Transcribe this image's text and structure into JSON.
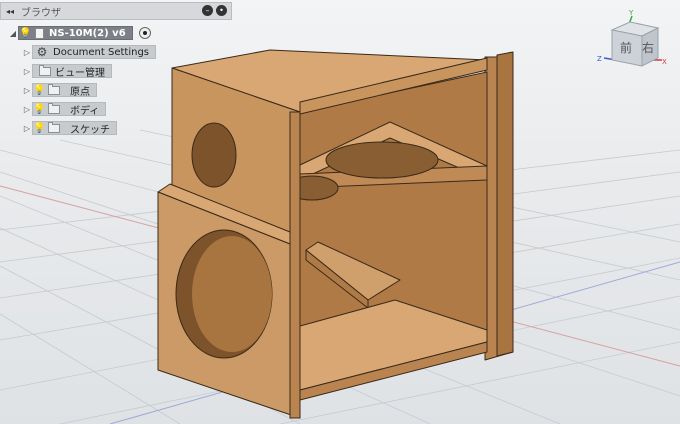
{
  "browser": {
    "title": "ブラウザ",
    "collapse_icon": "double-left-arrow-icon",
    "root": {
      "label": "NS-10M(2) v6"
    },
    "items": [
      {
        "label": "Document Settings",
        "icon": "gear-icon"
      },
      {
        "label": "ビュー管理",
        "icon": "folder-icon"
      },
      {
        "label": "原点",
        "icon": "folder-icon"
      },
      {
        "label": "ボディ",
        "icon": "folder-icon"
      },
      {
        "label": "スケッチ",
        "icon": "folder-icon"
      }
    ]
  },
  "viewcube": {
    "front_label": "前",
    "right_label": "右",
    "axis_x": "X",
    "axis_y": "Y",
    "axis_z": "Z"
  },
  "colors": {
    "wood": "#c9955f",
    "wood_dark": "#a8743f",
    "wood_light": "#d8a774",
    "background": "#e9ecef",
    "grid": "#c8ccd0"
  }
}
